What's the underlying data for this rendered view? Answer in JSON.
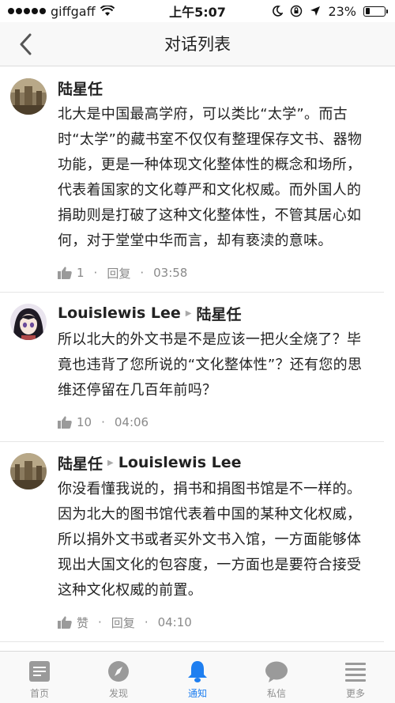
{
  "status": {
    "carrier": "giffgaff",
    "time": "上午5:07",
    "battery": "23%",
    "battery_level": 0.23
  },
  "nav": {
    "title": "对话列表"
  },
  "comments": [
    {
      "author": "陆星任",
      "reply_to": "",
      "text": "北大是中国最高学府，可以类比“太学”。而古时“太学”的藏书室不仅仅有整理保存文书、器物功能，更是一种体现文化整体性的概念和场所，代表着国家的文化尊严和文化权威。而外国人的捐助则是打破了这种文化整体性，不管其居心如何，对于堂堂中华而言，却有亵渎的意味。",
      "likes": "1",
      "reply_label": "回复",
      "time": "03:58"
    },
    {
      "author": "Louislewis Lee",
      "reply_to": "陆星任",
      "text": "所以北大的外文书是不是应该一把火全烧了？毕竟也违背了您所说的“文化整体性”？还有您的思维还停留在几百年前吗？",
      "likes": "10",
      "reply_label": "",
      "time": "04:06"
    },
    {
      "author": "陆星任",
      "reply_to": "Louislewis Lee",
      "text": "你没看懂我说的，捐书和捐图书馆是不一样的。因为北大的图书馆代表着中国的某种文化权威，所以捐外文书或者买外文书入馆，一方面能够体现出大国文化的包容度，一方面也是要符合接受这种文化权威的前置。",
      "likes": "赞",
      "reply_label": "回复",
      "time": "04:10"
    }
  ],
  "tabs": [
    {
      "label": "首页",
      "icon": "home-icon"
    },
    {
      "label": "发现",
      "icon": "compass-icon"
    },
    {
      "label": "通知",
      "icon": "bell-icon",
      "active": true
    },
    {
      "label": "私信",
      "icon": "message-icon"
    },
    {
      "label": "更多",
      "icon": "more-icon"
    }
  ],
  "colors": {
    "accent": "#1f7ff0",
    "meta": "#8a8a8a"
  }
}
